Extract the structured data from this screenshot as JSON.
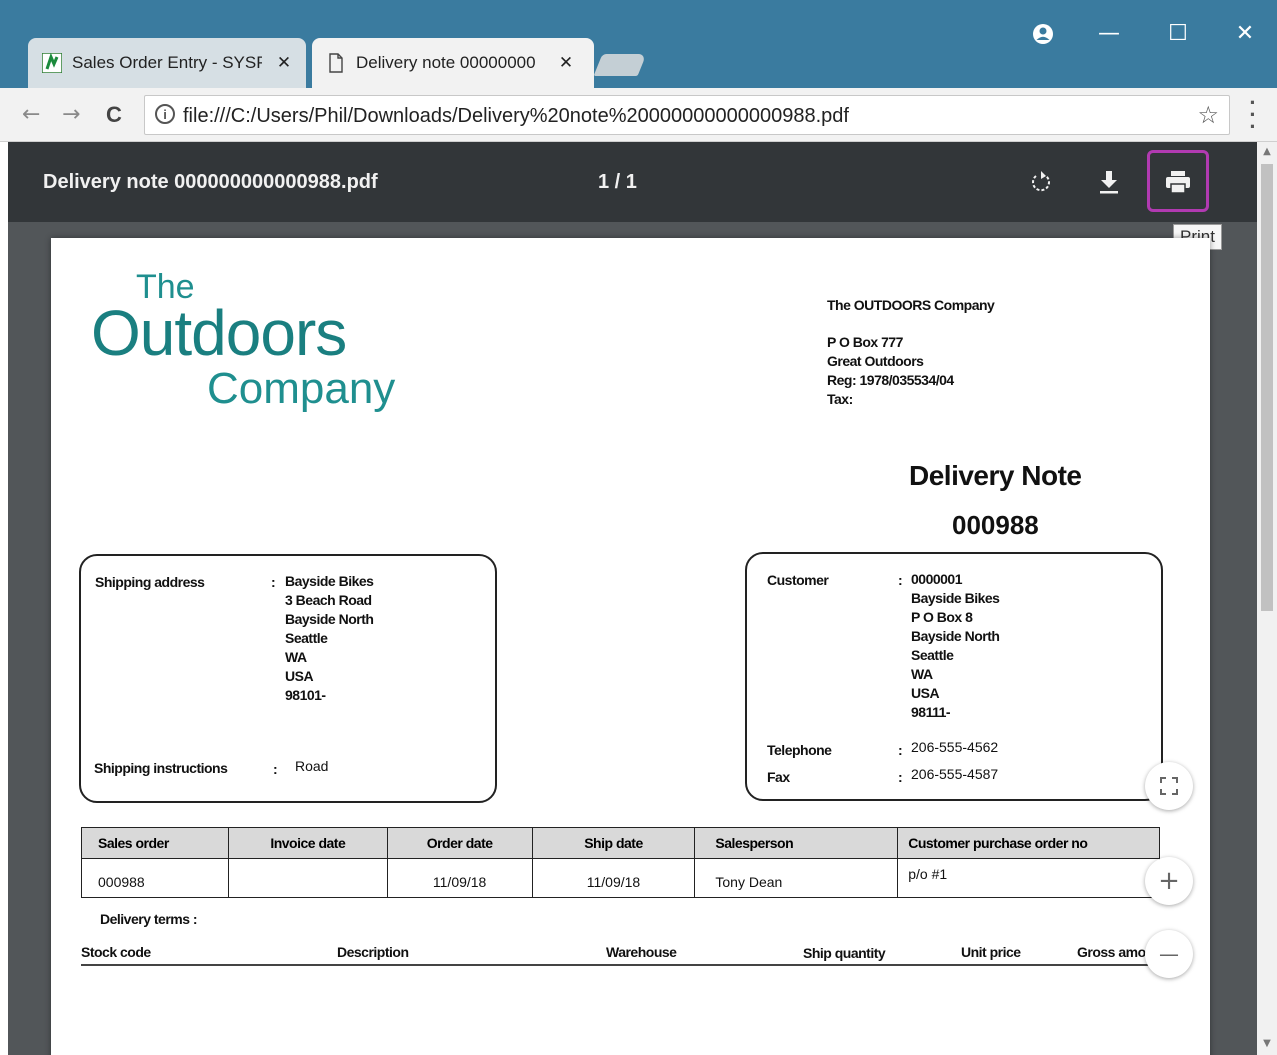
{
  "browser": {
    "tabs": [
      {
        "label": "Sales Order Entry - SYSPF",
        "active": false
      },
      {
        "label": "Delivery note 000000000",
        "active": true
      }
    ],
    "close_glyph": "✕",
    "url": "file:///C:/Users/Phil/Downloads/Delivery%20note%20000000000000988.pdf",
    "window_controls": {
      "profile": "profile-icon",
      "minimize": "—",
      "maximize": "☐",
      "close": "✕"
    },
    "nav": {
      "back": "←",
      "forward": "→",
      "reload": "C"
    }
  },
  "pdf_viewer": {
    "title": "Delivery note 000000000000988.pdf",
    "page_indicator": "1  /  1",
    "tooltip": "Print",
    "highlight_color": "#b13ab1"
  },
  "document": {
    "logo": {
      "the": "The",
      "outdoors": "Outdoors",
      "company": "Company"
    },
    "company": {
      "name": "The OUTDOORS Company",
      "address_1": "P O Box 777",
      "address_2": "Great Outdoors",
      "reg": "Reg: 1978/035534/04",
      "tax": "Tax:"
    },
    "heading": "Delivery Note",
    "number": "000988",
    "shipping": {
      "address_label": "Shipping address",
      "colon": ":",
      "address_lines": [
        "Bayside Bikes",
        "3 Beach Road",
        "Bayside North",
        "Seattle",
        "WA",
        "USA",
        "98101-"
      ],
      "instructions_label": "Shipping instructions",
      "instructions": "Road"
    },
    "customer": {
      "label": "Customer",
      "colon": ":",
      "lines": [
        "0000001",
        "Bayside Bikes",
        "P O Box 8",
        "Bayside North",
        "Seattle",
        "WA",
        "USA",
        "98111-"
      ],
      "telephone_label": "Telephone",
      "telephone": "206-555-4562",
      "fax_label": "Fax",
      "fax": "206-555-4587"
    },
    "orders_table": {
      "headers": [
        "Sales order",
        "Invoice date",
        "Order date",
        "Ship date",
        "Salesperson",
        "Customer purchase order no"
      ],
      "row": [
        "000988",
        "",
        "11/09/18",
        "11/09/18",
        "Tony Dean",
        "p/o #1"
      ]
    },
    "delivery_terms_label": "Delivery terms :",
    "line_headers": [
      "Stock code",
      "Description",
      "Warehouse",
      "Ship quantity",
      "Unit price",
      "Gross amo"
    ]
  },
  "controls": {
    "fit": "⛶",
    "zoom_in": "+",
    "zoom_out": "—"
  }
}
